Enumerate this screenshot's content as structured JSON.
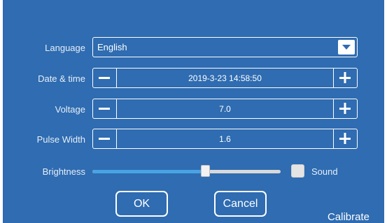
{
  "settings": {
    "language": {
      "label": "Language",
      "value": "English"
    },
    "datetime": {
      "label": "Date & time",
      "value": "2019-3-23 14:58:50"
    },
    "voltage": {
      "label": "Voltage",
      "value": "7.0"
    },
    "pulse_width": {
      "label": "Pulse Width",
      "value": "1.6"
    },
    "brightness": {
      "label": "Brightness",
      "level": 0.6
    },
    "sound": {
      "label": "Sound",
      "checked": false
    }
  },
  "buttons": {
    "ok": "OK",
    "cancel": "Cancel",
    "calibrate": "Calibrate"
  },
  "icons": {
    "dropdown": "chevron-down-icon",
    "minus": "minus-icon",
    "plus": "plus-icon"
  },
  "colors": {
    "panel": "#2f6cb1",
    "border": "#ffffff",
    "slider_fill": "#4aa3e3",
    "slider_track": "#d9d9d9"
  }
}
